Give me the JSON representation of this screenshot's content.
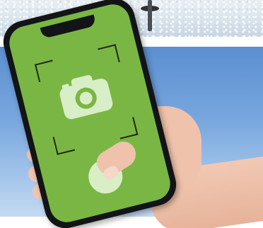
{
  "scene": {
    "background_top": "snow-photo",
    "background_main": "sky"
  },
  "device": {
    "screen_color": "#7ab644",
    "frame_color": "#121416"
  },
  "camera_app": {
    "icon": "camera-icon",
    "viewfinder": "viewfinder-frame",
    "shutter": "shutter-button"
  },
  "colors": {
    "screen_green": "#7ab644",
    "icon_light": "#d8eec6",
    "frame_dark": "#1f2a17",
    "sky": "#7aa8df"
  }
}
